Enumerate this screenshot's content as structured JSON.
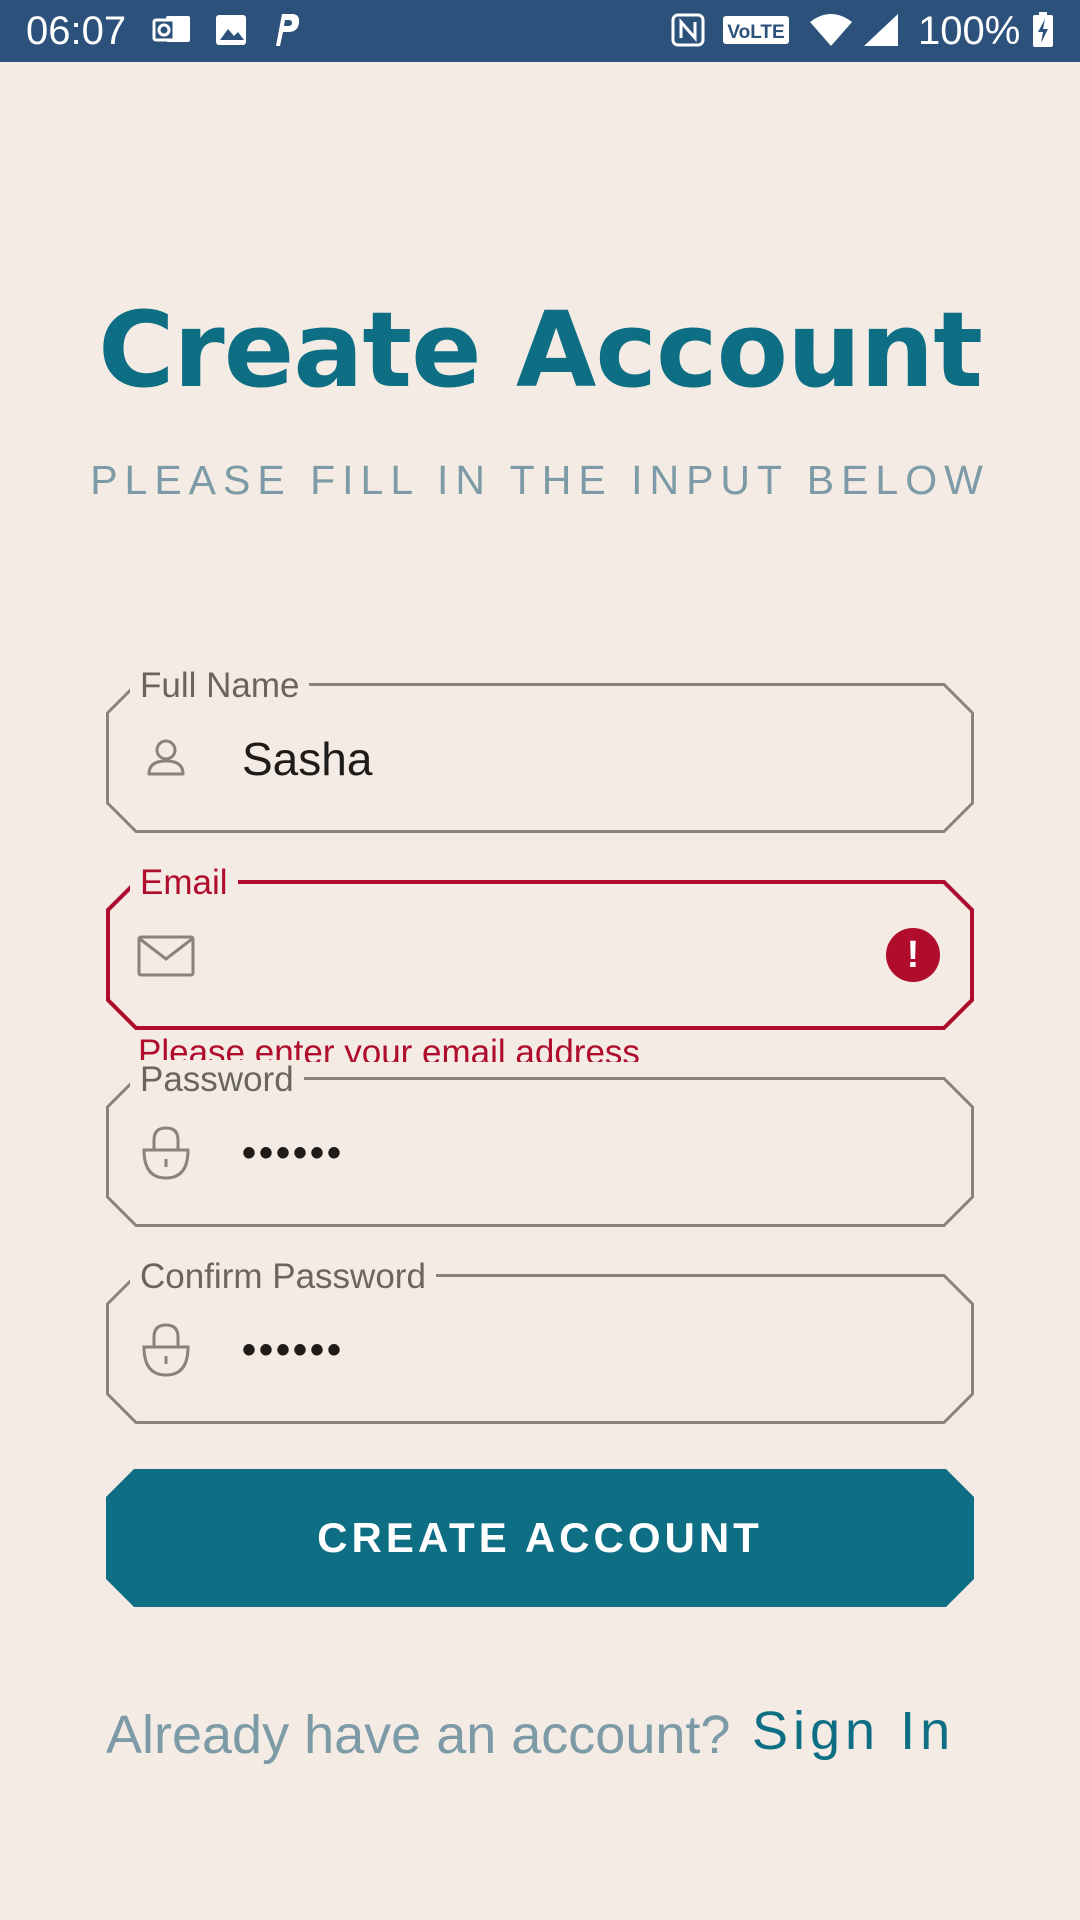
{
  "status_bar": {
    "time": "06:07",
    "battery": "100%",
    "icons": [
      "outlook-icon",
      "gallery-icon",
      "parking-icon",
      "nfc-icon",
      "volte-icon",
      "wifi-icon",
      "signal-icon",
      "battery-charging-icon"
    ],
    "volte_label": "VoLTE"
  },
  "header": {
    "title": "Create Account",
    "subtitle": "PLEASE FILL IN THE INPUT BELOW"
  },
  "form": {
    "full_name": {
      "label": "Full Name",
      "value": "Sasha",
      "icon": "person-icon"
    },
    "email": {
      "label": "Email",
      "value": "",
      "icon": "mail-icon",
      "error_icon": "error-icon",
      "error_symbol": "!",
      "error_message": "Please enter your email address"
    },
    "password": {
      "label": "Password",
      "value": "••••••",
      "icon": "lock-icon"
    },
    "confirm_password": {
      "label": "Confirm Password",
      "value": "••••••",
      "icon": "lock-icon"
    }
  },
  "actions": {
    "create_account_label": "CREATE ACCOUNT"
  },
  "footer": {
    "prompt": "Already have an account?",
    "sign_in_label": "Sign In"
  },
  "colors": {
    "background": "#f3ebe4",
    "status_bar": "#2c527b",
    "primary": "#0d6e84",
    "muted": "#7d9ba6",
    "error": "#b00c2c",
    "outline": "#8a837d"
  }
}
